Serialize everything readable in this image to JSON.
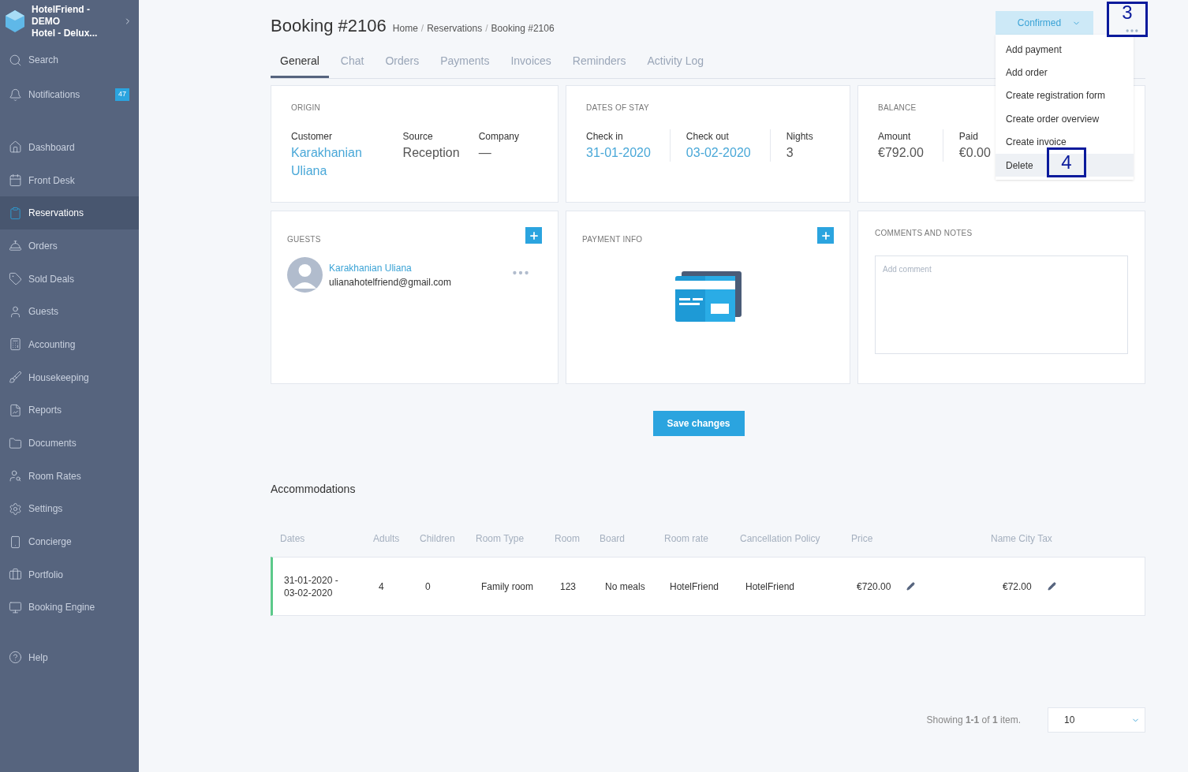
{
  "sidebar": {
    "hotel": {
      "line1": "HotelFriend - DEMO",
      "line2": "Hotel - Delux..."
    },
    "top_items": [
      {
        "label": "Search"
      },
      {
        "label": "Notifications",
        "badge": "47"
      }
    ],
    "items": [
      {
        "label": "Dashboard",
        "selected": false
      },
      {
        "label": "Front Desk",
        "selected": false
      },
      {
        "label": "Reservations",
        "selected": true
      },
      {
        "label": "Orders",
        "selected": false
      },
      {
        "label": "Sold Deals",
        "selected": false
      },
      {
        "label": "Guests",
        "selected": false
      },
      {
        "label": "Accounting",
        "selected": false
      },
      {
        "label": "Housekeeping",
        "selected": false
      },
      {
        "label": "Reports",
        "selected": false
      },
      {
        "label": "Documents",
        "selected": false
      },
      {
        "label": "Room Rates",
        "selected": false
      },
      {
        "label": "Settings",
        "selected": false
      },
      {
        "label": "Concierge",
        "selected": false
      },
      {
        "label": "Portfolio",
        "selected": false
      },
      {
        "label": "Booking Engine",
        "selected": false
      }
    ],
    "help": {
      "label": "Help"
    }
  },
  "header": {
    "title": "Booking #2106",
    "breadcrumb": [
      "Home",
      "Reservations",
      "Booking #2106"
    ],
    "breadcrumb_separator": "/",
    "status": "Confirmed"
  },
  "menu": [
    {
      "label": "Add payment",
      "highlighted": false
    },
    {
      "label": "Add order",
      "highlighted": false
    },
    {
      "label": "Create registration form",
      "highlighted": false
    },
    {
      "label": "Create order overview",
      "highlighted": false
    },
    {
      "label": "Create invoice",
      "highlighted": false
    },
    {
      "label": "Delete",
      "highlighted": true
    }
  ],
  "annotations": [
    {
      "label": "3"
    },
    {
      "label": "4"
    }
  ],
  "tabs": [
    {
      "label": "General",
      "selected": true
    },
    {
      "label": "Chat",
      "selected": false
    },
    {
      "label": "Orders",
      "selected": false
    },
    {
      "label": "Payments",
      "selected": false
    },
    {
      "label": "Invoices",
      "selected": false
    },
    {
      "label": "Reminders",
      "selected": false
    },
    {
      "label": "Activity Log",
      "selected": false
    }
  ],
  "origin": {
    "title": "ORIGIN",
    "fields": [
      {
        "label": "Customer",
        "value": "Karakhanian Uliana",
        "link": true
      },
      {
        "label": "Source",
        "value": "Reception",
        "link": false
      },
      {
        "label": "Company",
        "value": "—",
        "link": false
      }
    ]
  },
  "dates": {
    "title": "DATES OF STAY",
    "fields": [
      {
        "label": "Check in",
        "value": "31-01-2020",
        "link": true
      },
      {
        "label": "Check out",
        "value": "03-02-2020",
        "link": true
      },
      {
        "label": "Nights",
        "value": "3",
        "link": false
      }
    ]
  },
  "balance": {
    "title": "BALANCE",
    "fields": [
      {
        "label": "Amount",
        "value": "€792.00",
        "link": false
      },
      {
        "label": "Paid",
        "value": "€0.00",
        "link": false
      }
    ]
  },
  "guests": {
    "title": "GUESTS",
    "list": [
      {
        "name": "Karakhanian Uliana",
        "email": "ulianahotelfriend@gmail.com"
      }
    ]
  },
  "payment_info": {
    "title": "PAYMENT INFO"
  },
  "comments": {
    "title": "COMMENTS AND NOTES",
    "placeholder": "Add comment"
  },
  "save_button": "Save changes",
  "accommodations": {
    "title": "Accommodations",
    "columns": [
      "Dates",
      "Adults",
      "Children",
      "Room Type",
      "Room",
      "Board",
      "Room rate",
      "Cancellation Policy",
      "Price",
      "Name City Tax"
    ],
    "rows": [
      {
        "cells": [
          "31-01-2020 - 03-02-2020",
          "4",
          "0",
          "Family room",
          "123",
          "No meals",
          "HotelFriend",
          "HotelFriend",
          "€720.00",
          "€72.00"
        ]
      }
    ]
  },
  "pagination": {
    "summary": "Showing **1-1** of **1** item.",
    "per_page": "10"
  }
}
